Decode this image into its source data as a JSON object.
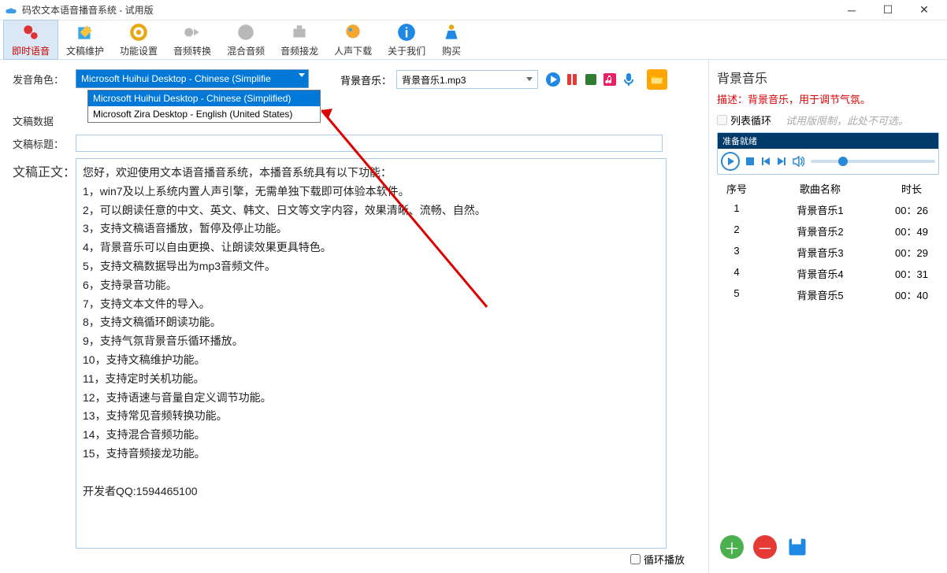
{
  "window": {
    "title": "码农文本语音播音系统 - 试用版"
  },
  "toolbar": {
    "items": [
      {
        "label": "即时语音",
        "active": true
      },
      {
        "label": "文稿维护"
      },
      {
        "label": "功能设置"
      },
      {
        "label": "音频转换"
      },
      {
        "label": "混合音频"
      },
      {
        "label": "音频接龙"
      },
      {
        "label": "人声下载"
      },
      {
        "label": "关于我们"
      },
      {
        "label": "购买"
      }
    ]
  },
  "left": {
    "voice_label": "发音角色：",
    "voice_selected": "Microsoft Huihui Desktop - Chinese (Simplifie",
    "voice_options": [
      "Microsoft Huihui Desktop - Chinese (Simplified)",
      "Microsoft Zira Desktop - English (United States)"
    ],
    "doc_data_label": "文稿数据",
    "doc_title_label": "文稿标题：",
    "doc_title_value": "",
    "doc_body_label": "文稿正文：",
    "doc_body": "您好，欢迎使用文本语音播音系统，本播音系统具有以下功能：\n1，win7及以上系统内置人声引擎，无需单独下载即可体验本软件。\n2，可以朗读任意的中文、英文、韩文、日文等文字内容，效果清晰、流畅、自然。\n3，支持文稿语音播放，暂停及停止功能。\n4，背景音乐可以自由更换、让朗读效果更具特色。\n5，支持文稿数据导出为mp3音频文件。\n6，支持录音功能。\n7，支持文本文件的导入。\n8，支持文稿循环朗读功能。\n9，支持气氛背景音乐循环播放。\n10，支持文稿维护功能。\n11，支持定时关机功能。\n12，支持语速与音量自定义调节功能。\n13，支持常见音频转换功能。\n14，支持混合音频功能。\n15，支持音频接龙功能。\n\n开发者QQ:1594465100",
    "bg_music_label": "背景音乐：",
    "bg_music_value": "背景音乐1.mp3",
    "loop_label": "循环播放"
  },
  "right": {
    "title": "背景音乐",
    "desc": "描述：背景音乐，用于调节气氛。",
    "list_loop_label": "列表循环",
    "trial_hint": "试用版限制，此处不可选。",
    "player_status": "准备就绪",
    "headers": {
      "idx": "序号",
      "name": "歌曲名称",
      "dur": "时长"
    },
    "tracks": [
      {
        "idx": "1",
        "name": "背景音乐1",
        "dur": "00：26"
      },
      {
        "idx": "2",
        "name": "背景音乐2",
        "dur": "00：49"
      },
      {
        "idx": "3",
        "name": "背景音乐3",
        "dur": "00：29"
      },
      {
        "idx": "4",
        "name": "背景音乐4",
        "dur": "00：31"
      },
      {
        "idx": "5",
        "name": "背景音乐5",
        "dur": "00：40"
      }
    ]
  }
}
